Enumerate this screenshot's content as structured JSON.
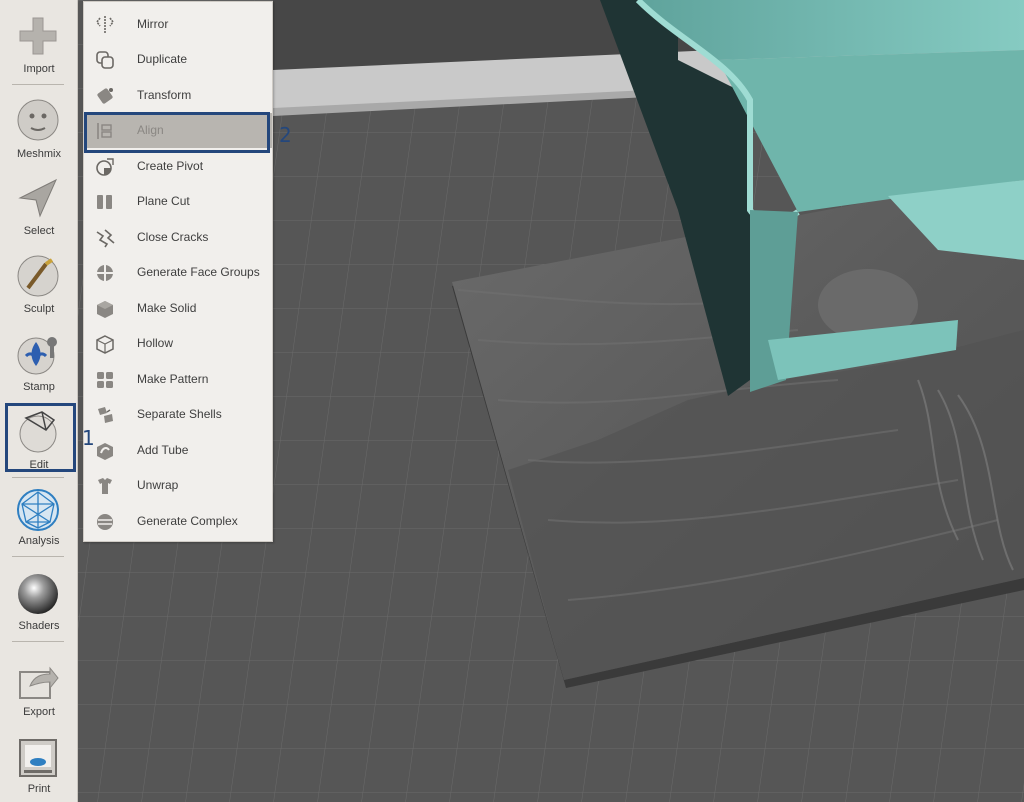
{
  "toolbar": {
    "items": [
      {
        "label": "Import",
        "icon": "plus-icon"
      },
      {
        "label": "Meshmix",
        "icon": "meshmix-face-icon"
      },
      {
        "label": "Select",
        "icon": "select-arrow-icon"
      },
      {
        "label": "Sculpt",
        "icon": "sculpt-brush-icon"
      },
      {
        "label": "Stamp",
        "icon": "stamp-fleur-icon"
      },
      {
        "label": "Edit",
        "icon": "edit-sphere-icon"
      },
      {
        "label": "Analysis",
        "icon": "analysis-mesh-icon"
      },
      {
        "label": "Shaders",
        "icon": "shader-sphere-icon"
      },
      {
        "label": "Export",
        "icon": "export-arrow-icon"
      },
      {
        "label": "Print",
        "icon": "printer-icon"
      }
    ]
  },
  "edit_menu": {
    "items": [
      {
        "label": "Mirror",
        "icon": "mirror-icon"
      },
      {
        "label": "Duplicate",
        "icon": "duplicate-icon"
      },
      {
        "label": "Transform",
        "icon": "transform-icon"
      },
      {
        "label": "Align",
        "icon": "align-icon",
        "selected": true
      },
      {
        "label": "Create Pivot",
        "icon": "pivot-icon"
      },
      {
        "label": "Plane Cut",
        "icon": "plane-cut-icon"
      },
      {
        "label": "Close Cracks",
        "icon": "close-cracks-icon"
      },
      {
        "label": "Generate Face Groups",
        "icon": "face-groups-icon"
      },
      {
        "label": "Make Solid",
        "icon": "make-solid-icon"
      },
      {
        "label": "Hollow",
        "icon": "hollow-icon"
      },
      {
        "label": "Make Pattern",
        "icon": "pattern-icon"
      },
      {
        "label": "Separate Shells",
        "icon": "separate-shells-icon"
      },
      {
        "label": "Add Tube",
        "icon": "add-tube-icon"
      },
      {
        "label": "Unwrap",
        "icon": "unwrap-icon"
      },
      {
        "label": "Generate Complex",
        "icon": "generate-complex-icon"
      }
    ]
  },
  "callouts": {
    "edit_number": "1",
    "align_number": "2"
  },
  "colors": {
    "callout": "#24477c",
    "model": "#7bbfb6",
    "terrain": "#5e5e5e"
  }
}
